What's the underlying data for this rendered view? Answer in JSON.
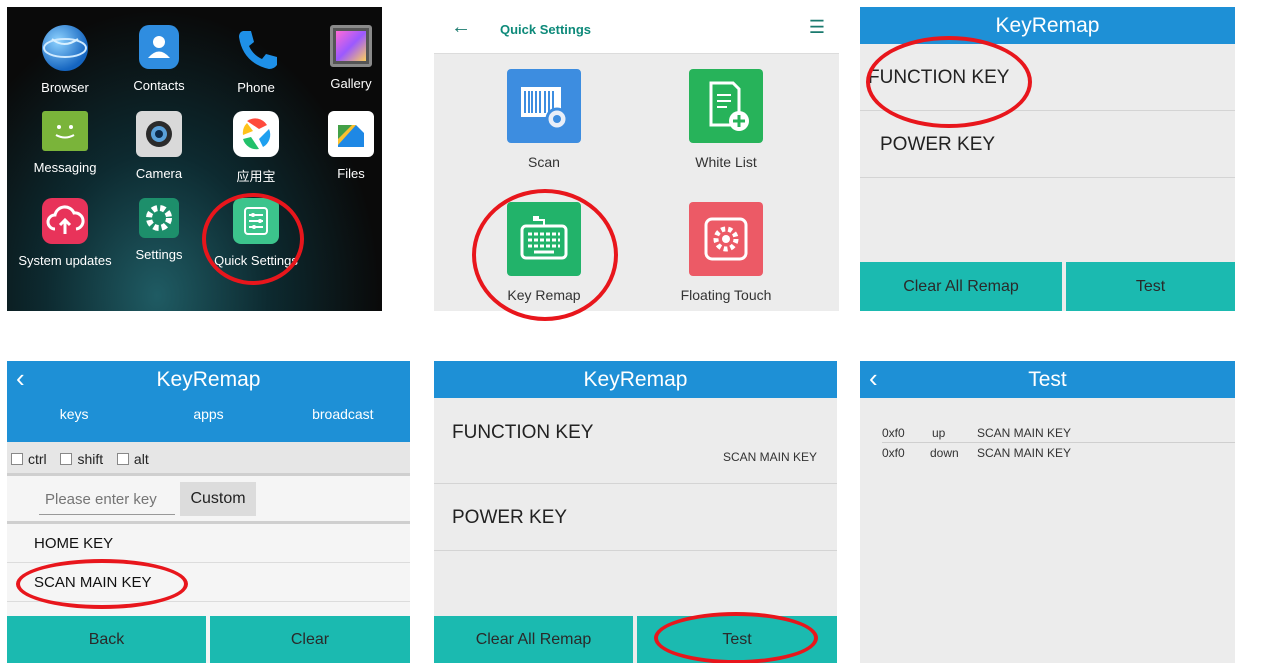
{
  "launcher": {
    "apps": [
      {
        "label": "Browser",
        "icon": "globe-icon"
      },
      {
        "label": "Contacts",
        "icon": "contacts-icon"
      },
      {
        "label": "Phone",
        "icon": "phone-icon"
      },
      {
        "label": "Gallery",
        "icon": "gallery-icon"
      },
      {
        "label": "Messaging",
        "icon": "messaging-icon"
      },
      {
        "label": "Camera",
        "icon": "camera-icon"
      },
      {
        "label": "应用宝",
        "icon": "app-store-icon"
      },
      {
        "label": "Files",
        "icon": "files-icon"
      },
      {
        "label": "System updates",
        "icon": "cloud-upload-icon"
      },
      {
        "label": "Settings",
        "icon": "gear-icon"
      },
      {
        "label": "Quick Settings",
        "icon": "quick-settings-icon"
      }
    ]
  },
  "quick_settings": {
    "title": "Quick Settings",
    "tiles": [
      {
        "label": "Scan",
        "color": "#3d8de0",
        "icon": "barcode-scan-icon"
      },
      {
        "label": "White List",
        "color": "#27b35a",
        "icon": "whitelist-icon"
      },
      {
        "label": "Key Remap",
        "color": "#22b36a",
        "icon": "keyboard-icon"
      },
      {
        "label": "Floating Touch",
        "color": "#ec5a66",
        "icon": "floating-touch-icon"
      }
    ]
  },
  "keyremap_main": {
    "title": "KeyRemap",
    "rows": [
      "FUNCTION KEY",
      "POWER KEY"
    ],
    "clear_all_label": "Clear All Remap",
    "test_label": "Test"
  },
  "keyremap_select": {
    "title": "KeyRemap",
    "tabs": [
      "keys",
      "apps",
      "broadcast"
    ],
    "modifiers": [
      "ctrl",
      "shift",
      "alt"
    ],
    "input_placeholder": "Please enter key",
    "custom_label": "Custom",
    "keys": [
      "HOME KEY",
      "SCAN MAIN KEY"
    ],
    "back_label": "Back",
    "clear_label": "Clear"
  },
  "keyremap_mapped": {
    "title": "KeyRemap",
    "rows": [
      {
        "label": "FUNCTION KEY",
        "mapped": "SCAN MAIN KEY"
      },
      {
        "label": "POWER KEY",
        "mapped": ""
      }
    ],
    "clear_all_label": "Clear All Remap",
    "test_label": "Test"
  },
  "test": {
    "title": "Test",
    "log": [
      {
        "code": "0xf0",
        "action": "up",
        "key": "SCAN MAIN KEY"
      },
      {
        "code": "0xf0",
        "action": "down",
        "key": "SCAN MAIN KEY"
      }
    ]
  },
  "colors": {
    "header_blue": "#1e90d6",
    "button_teal": "#1bbab0",
    "highlight_red": "#e8161c",
    "accent_green": "#0e8a7a"
  }
}
